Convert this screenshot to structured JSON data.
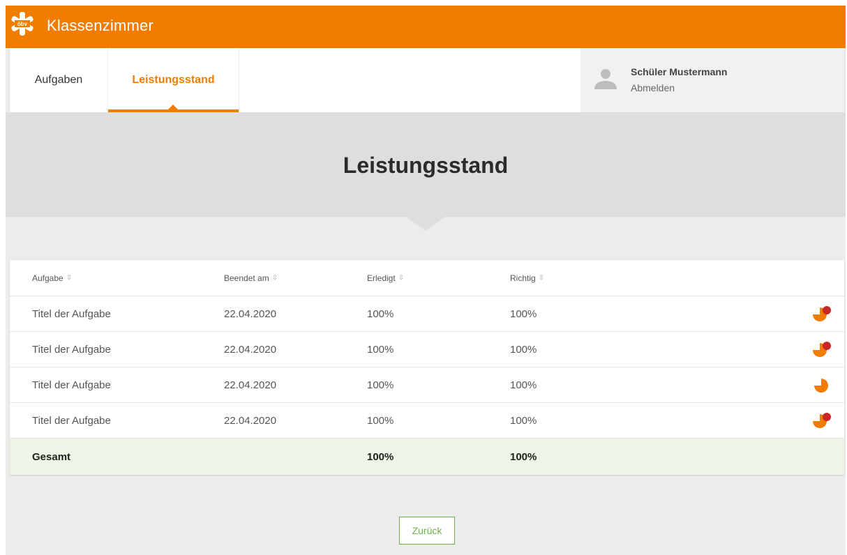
{
  "app": {
    "title": "Klassenzimmer",
    "logo_text": "öbv"
  },
  "nav": {
    "tabs": [
      {
        "label": "Aufgaben",
        "active": false
      },
      {
        "label": "Leistungsstand",
        "active": true
      }
    ],
    "user": {
      "name": "Schüler Mustermann",
      "logout_label": "Abmelden"
    }
  },
  "hero": {
    "title": "Leistungsstand"
  },
  "table": {
    "columns": [
      "Aufgabe",
      "Beendet am",
      "Erledigt",
      "Richtig"
    ],
    "rows": [
      {
        "task": "Titel der Aufgabe",
        "finished": "22.04.2020",
        "done": "100%",
        "correct": "100%",
        "status_icon": "pie-icon-with-alert"
      },
      {
        "task": "Titel der Aufgabe",
        "finished": "22.04.2020",
        "done": "100%",
        "correct": "100%",
        "status_icon": "pie-icon-with-alert"
      },
      {
        "task": "Titel der Aufgabe",
        "finished": "22.04.2020",
        "done": "100%",
        "correct": "100%",
        "status_icon": "pie-icon"
      },
      {
        "task": "Titel der Aufgabe",
        "finished": "22.04.2020",
        "done": "100%",
        "correct": "100%",
        "status_icon": "pie-icon-with-alert"
      }
    ],
    "total": {
      "label": "Gesamt",
      "done": "100%",
      "correct": "100%"
    }
  },
  "back_button": {
    "label": "Zurück"
  },
  "colors": {
    "accent": "#f07c00",
    "alert": "#c62828",
    "success": "#6ab04c",
    "total_row_bg": "#eef5e6"
  }
}
